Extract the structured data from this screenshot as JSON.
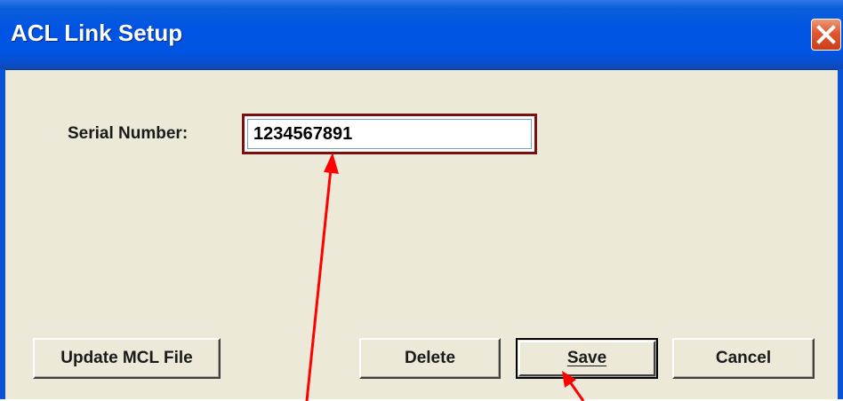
{
  "window": {
    "title": "ACL Link Setup"
  },
  "form": {
    "serial_label": "Serial Number:",
    "serial_value": "1234567891"
  },
  "buttons": {
    "update_mcl": "Update MCL File",
    "delete": "Delete",
    "save": "Save",
    "cancel": "Cancel"
  },
  "icons": {
    "close": "close-x-icon"
  },
  "colors": {
    "titlebar": "#0054e3",
    "dialog_bg": "#ece9d8",
    "close_button": "#e2562e",
    "highlight_border": "#7a0f0f",
    "annotation_arrow": "#ff0000"
  }
}
